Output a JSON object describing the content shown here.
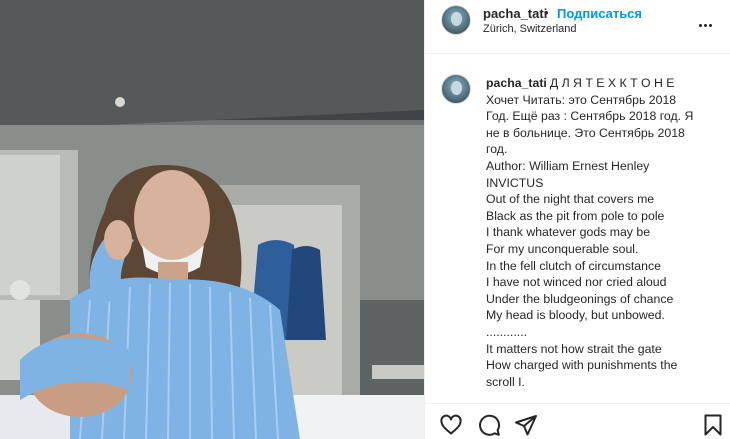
{
  "post": {
    "username": "pacha_tati",
    "separator": "•",
    "follow_label": "Подписаться",
    "location": "Zürich, Switzerland"
  },
  "caption": {
    "username": "pacha_tati",
    "lines": [
      "Д Л Я Т Е Х К Т О Н Е",
      "Хочет Читать: это Сентябрь 2018",
      "Год. Ещё раз : Сентябрь 2018 год. Я",
      "не в больнице. Это Сентябрь 2018",
      "год.",
      "Author: William Ernest Henley",
      "INVICTUS",
      "Out of the night that covers me",
      "Black as the pit from pole to pole",
      "I thank whatever gods may be",
      "For my unconquerable soul.",
      "In the fell clutch of circumstance",
      "I have not winced nor cried aloud",
      "Under the bludgeonings of chance",
      "My head is bloody, but unbowed.",
      "............",
      "It matters not how strait the gate",
      "How charged with punishments the",
      "scroll I."
    ]
  },
  "icons": {
    "more": "more-options-icon",
    "like": "heart-icon",
    "comment": "comment-icon",
    "share": "share-icon",
    "save": "bookmark-icon"
  },
  "colors": {
    "accent": "#0095f6",
    "text": "#262626",
    "border": "#efefef"
  }
}
